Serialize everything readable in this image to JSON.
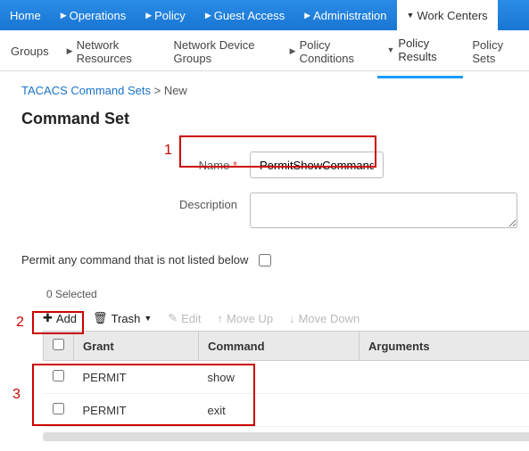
{
  "topnav": [
    {
      "label": "Home",
      "caret": false
    },
    {
      "label": "Operations",
      "caret": true
    },
    {
      "label": "Policy",
      "caret": true
    },
    {
      "label": "Guest Access",
      "caret": true
    },
    {
      "label": "Administration",
      "caret": true
    },
    {
      "label": "Work Centers",
      "caret": true,
      "active": true
    }
  ],
  "subnav": [
    {
      "label": "Groups"
    },
    {
      "label": "Network Resources",
      "caret": true
    },
    {
      "label": "Network Device Groups"
    },
    {
      "label": "Policy Conditions",
      "caret": true
    },
    {
      "label": "Policy Results",
      "caret": true,
      "active": true
    },
    {
      "label": "Policy Sets"
    }
  ],
  "breadcrumb": {
    "parent": "TACACS Command Sets",
    "sep": ">",
    "current": "New"
  },
  "page_title": "Command Set",
  "form": {
    "name_label": "Name",
    "name_value": "PermitShowCommands",
    "desc_label": "Description",
    "desc_value": "",
    "permit_any_label": "Permit any command that is not listed below",
    "permit_any_checked": false
  },
  "selection_count": "0 Selected",
  "toolbar": {
    "add": "Add",
    "trash": "Trash",
    "edit": "Edit",
    "moveup": "Move Up",
    "movedown": "Move Down"
  },
  "table": {
    "headers": {
      "grant": "Grant",
      "command": "Command",
      "arguments": "Arguments"
    },
    "rows": [
      {
        "grant": "PERMIT",
        "command": "show",
        "arguments": ""
      },
      {
        "grant": "PERMIT",
        "command": "exit",
        "arguments": ""
      }
    ]
  },
  "annotations": {
    "a1": "1",
    "a2": "2",
    "a3": "3"
  }
}
